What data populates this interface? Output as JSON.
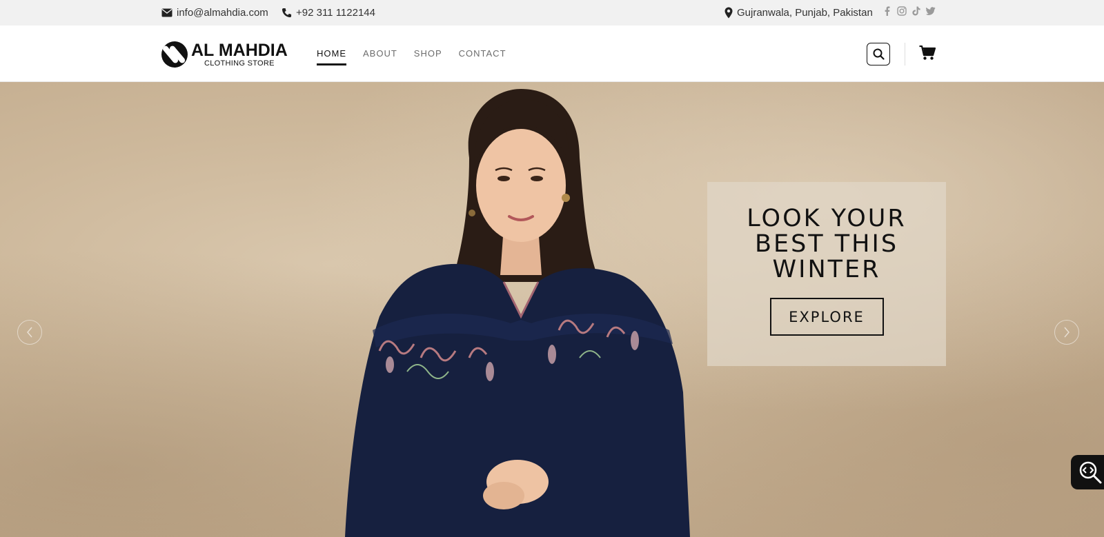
{
  "topbar": {
    "email": "info@almahdia.com",
    "phone": "+92 311 1122144",
    "location": "Gujranwala, Punjab, Pakistan",
    "social_icons": [
      "facebook-icon",
      "instagram-icon",
      "tiktok-icon",
      "twitter-icon"
    ]
  },
  "header": {
    "logo": {
      "title": "AL MAHDIA",
      "subtitle": "CLOTHING STORE"
    },
    "nav": [
      {
        "label": "HOME",
        "active": true
      },
      {
        "label": "ABOUT",
        "active": false
      },
      {
        "label": "SHOP",
        "active": false
      },
      {
        "label": "CONTACT",
        "active": false
      }
    ],
    "icons": [
      "search-icon",
      "cart-icon"
    ]
  },
  "hero": {
    "title": "LOOK YOUR BEST THIS WINTER",
    "button_label": "EXPLORE",
    "colors": {
      "background": "#cdb89b",
      "garment": "#16203f",
      "promo_box": "#e1d7c8"
    }
  },
  "widget": {
    "icon": "code-search-icon"
  }
}
